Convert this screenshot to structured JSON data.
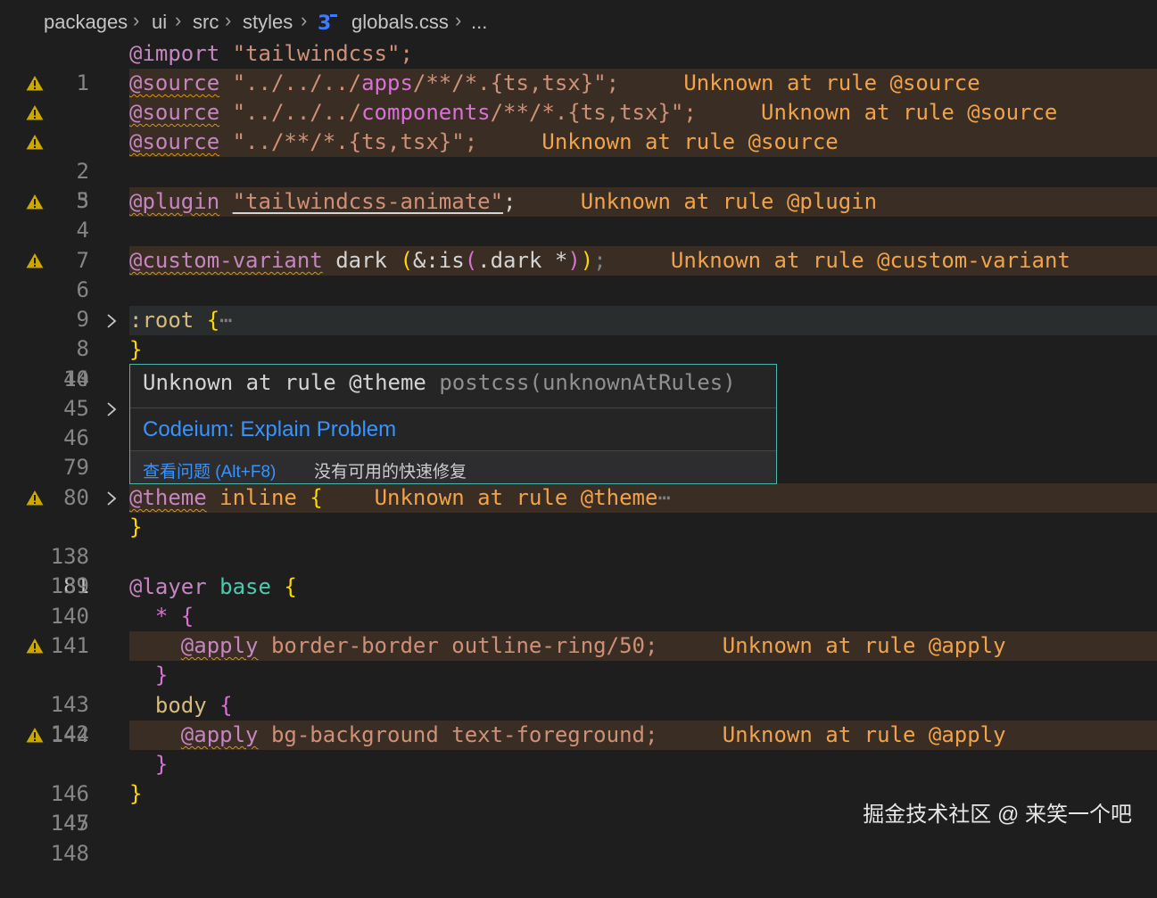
{
  "breadcrumb": {
    "items": [
      "packages",
      "ui",
      "src",
      "styles",
      "globals.css",
      "..."
    ],
    "file_icon": "css-file-icon"
  },
  "lines": [
    {
      "num": "1",
      "warn": false
    },
    {
      "num": "2",
      "warn": true,
      "msg": "Unknown at rule @source"
    },
    {
      "num": "3",
      "warn": true,
      "msg": "Unknown at rule @source"
    },
    {
      "num": "4",
      "warn": true,
      "msg": "Unknown at rule @source"
    },
    {
      "num": "5"
    },
    {
      "num": "6",
      "warn": true,
      "msg": "Unknown at rule @plugin"
    },
    {
      "num": "7"
    },
    {
      "num": "8",
      "warn": true,
      "msg": "Unknown at rule @custom-variant"
    },
    {
      "num": "9"
    },
    {
      "num": "10"
    },
    {
      "num": "44"
    },
    {
      "num": "45"
    },
    {
      "num": "46"
    },
    {
      "num": "79"
    },
    {
      "num": "80"
    },
    {
      "num": "81",
      "warn": true,
      "msg": "Unknown at rule @theme"
    },
    {
      "num": "138"
    },
    {
      "num": "139"
    },
    {
      "num": "140"
    },
    {
      "num": "141"
    },
    {
      "num": "142",
      "warn": true,
      "msg": "Unknown at rule @apply"
    },
    {
      "num": "143"
    },
    {
      "num": "144"
    },
    {
      "num": "145",
      "warn": true,
      "msg": "Unknown at rule @apply"
    },
    {
      "num": "146"
    },
    {
      "num": "147"
    },
    {
      "num": "148"
    }
  ],
  "code": {
    "l1": {
      "at": "@import",
      "s": " \"tailwindcss\";"
    },
    "l2": {
      "at": "@source",
      "s1": " \"../../../",
      "p": "apps",
      "s2": "/**/*.{ts,tsx}\";"
    },
    "l3": {
      "at": "@source",
      "s1": " \"../../../",
      "p": "components",
      "s2": "/**/*.{ts,tsx}\";"
    },
    "l4": {
      "at": "@source",
      "s": " \"../**/*.{ts,tsx}\";"
    },
    "l6": {
      "at": "@plugin",
      "str": "\"tailwindcss-animate\"",
      "semi": ";"
    },
    "l8": {
      "at": "@custom-variant",
      "a": " dark ",
      "b": "(",
      "c": "&:is",
      "d": "(",
      "e": ".dark *",
      "f": ")",
      "g": ")",
      "h": ";"
    },
    "l10": {
      "sel": ":root",
      "brace": " {",
      "ellipsis": "⋯"
    },
    "l44": {
      "brace": "}"
    },
    "l81": {
      "at": "@theme",
      "kw": " inline",
      "brace": " {",
      "ellipsis": "⋯"
    },
    "l138": {
      "brace": "}"
    },
    "l140": {
      "at": "@layer",
      "kw": " base",
      "brace": " {"
    },
    "l141": {
      "sel": "  *",
      "brace": " {"
    },
    "l142": {
      "at": "@apply",
      "v": " border-border outline-ring/50;"
    },
    "l143": {
      "brace": "}"
    },
    "l144": {
      "sel": "  body",
      "brace": " {"
    },
    "l145": {
      "at": "@apply",
      "v": " bg-background text-foreground;"
    },
    "l146": {
      "brace": "}"
    },
    "l147": {
      "brace": "}"
    }
  },
  "hover": {
    "message": "Unknown at rule @theme",
    "source": "postcss(unknownAtRules)",
    "action": "Codeium: Explain Problem",
    "view_problem": "查看问题 (Alt+F8)",
    "no_fix": "没有可用的快速修复"
  },
  "watermark": "掘金技术社区 @ 来笑一个吧",
  "colors": {
    "background": "#1e1e1e",
    "warning_line_bg": "#392d24",
    "warning_text": "#f0a34a",
    "warning_icon": "#cca700",
    "at_rule": "#c586c0",
    "string": "#ce9178",
    "link": "#3794ff"
  }
}
